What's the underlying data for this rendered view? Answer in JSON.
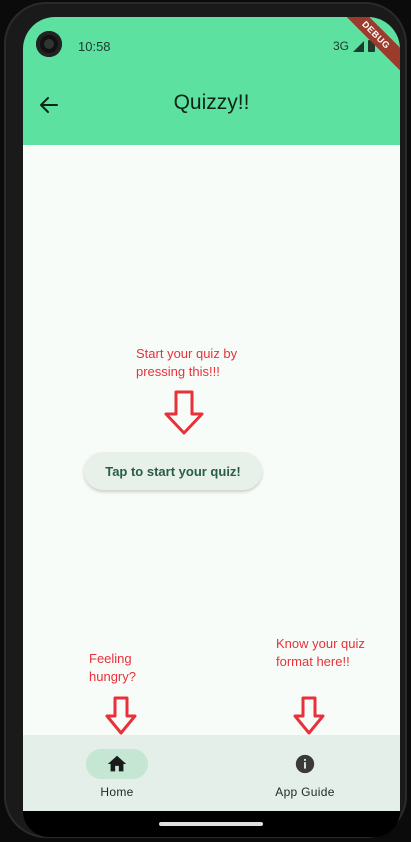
{
  "status_bar": {
    "time": "10:58",
    "network": "3G"
  },
  "debug_banner": "DEBUG",
  "app_bar": {
    "title": "Quizzy!!",
    "back_icon": "arrow-left-icon"
  },
  "notes": {
    "start": [
      "Start your quiz by",
      "pressing this!!!"
    ],
    "hungry": [
      "Feeling",
      "hungry?"
    ],
    "format": [
      "Know your quiz",
      "format here!!"
    ]
  },
  "start_button": {
    "label": "Tap to start your quiz!"
  },
  "bottom_nav": {
    "items": [
      {
        "label": "Home",
        "icon": "home-icon",
        "selected": true
      },
      {
        "label": "App Guide",
        "icon": "info-icon",
        "selected": false
      }
    ]
  },
  "colors": {
    "app_bar": "#5ce1a0",
    "note_red": "#e8313a",
    "nav_bg": "#e4efe9",
    "pill": "#c5e6d2"
  }
}
